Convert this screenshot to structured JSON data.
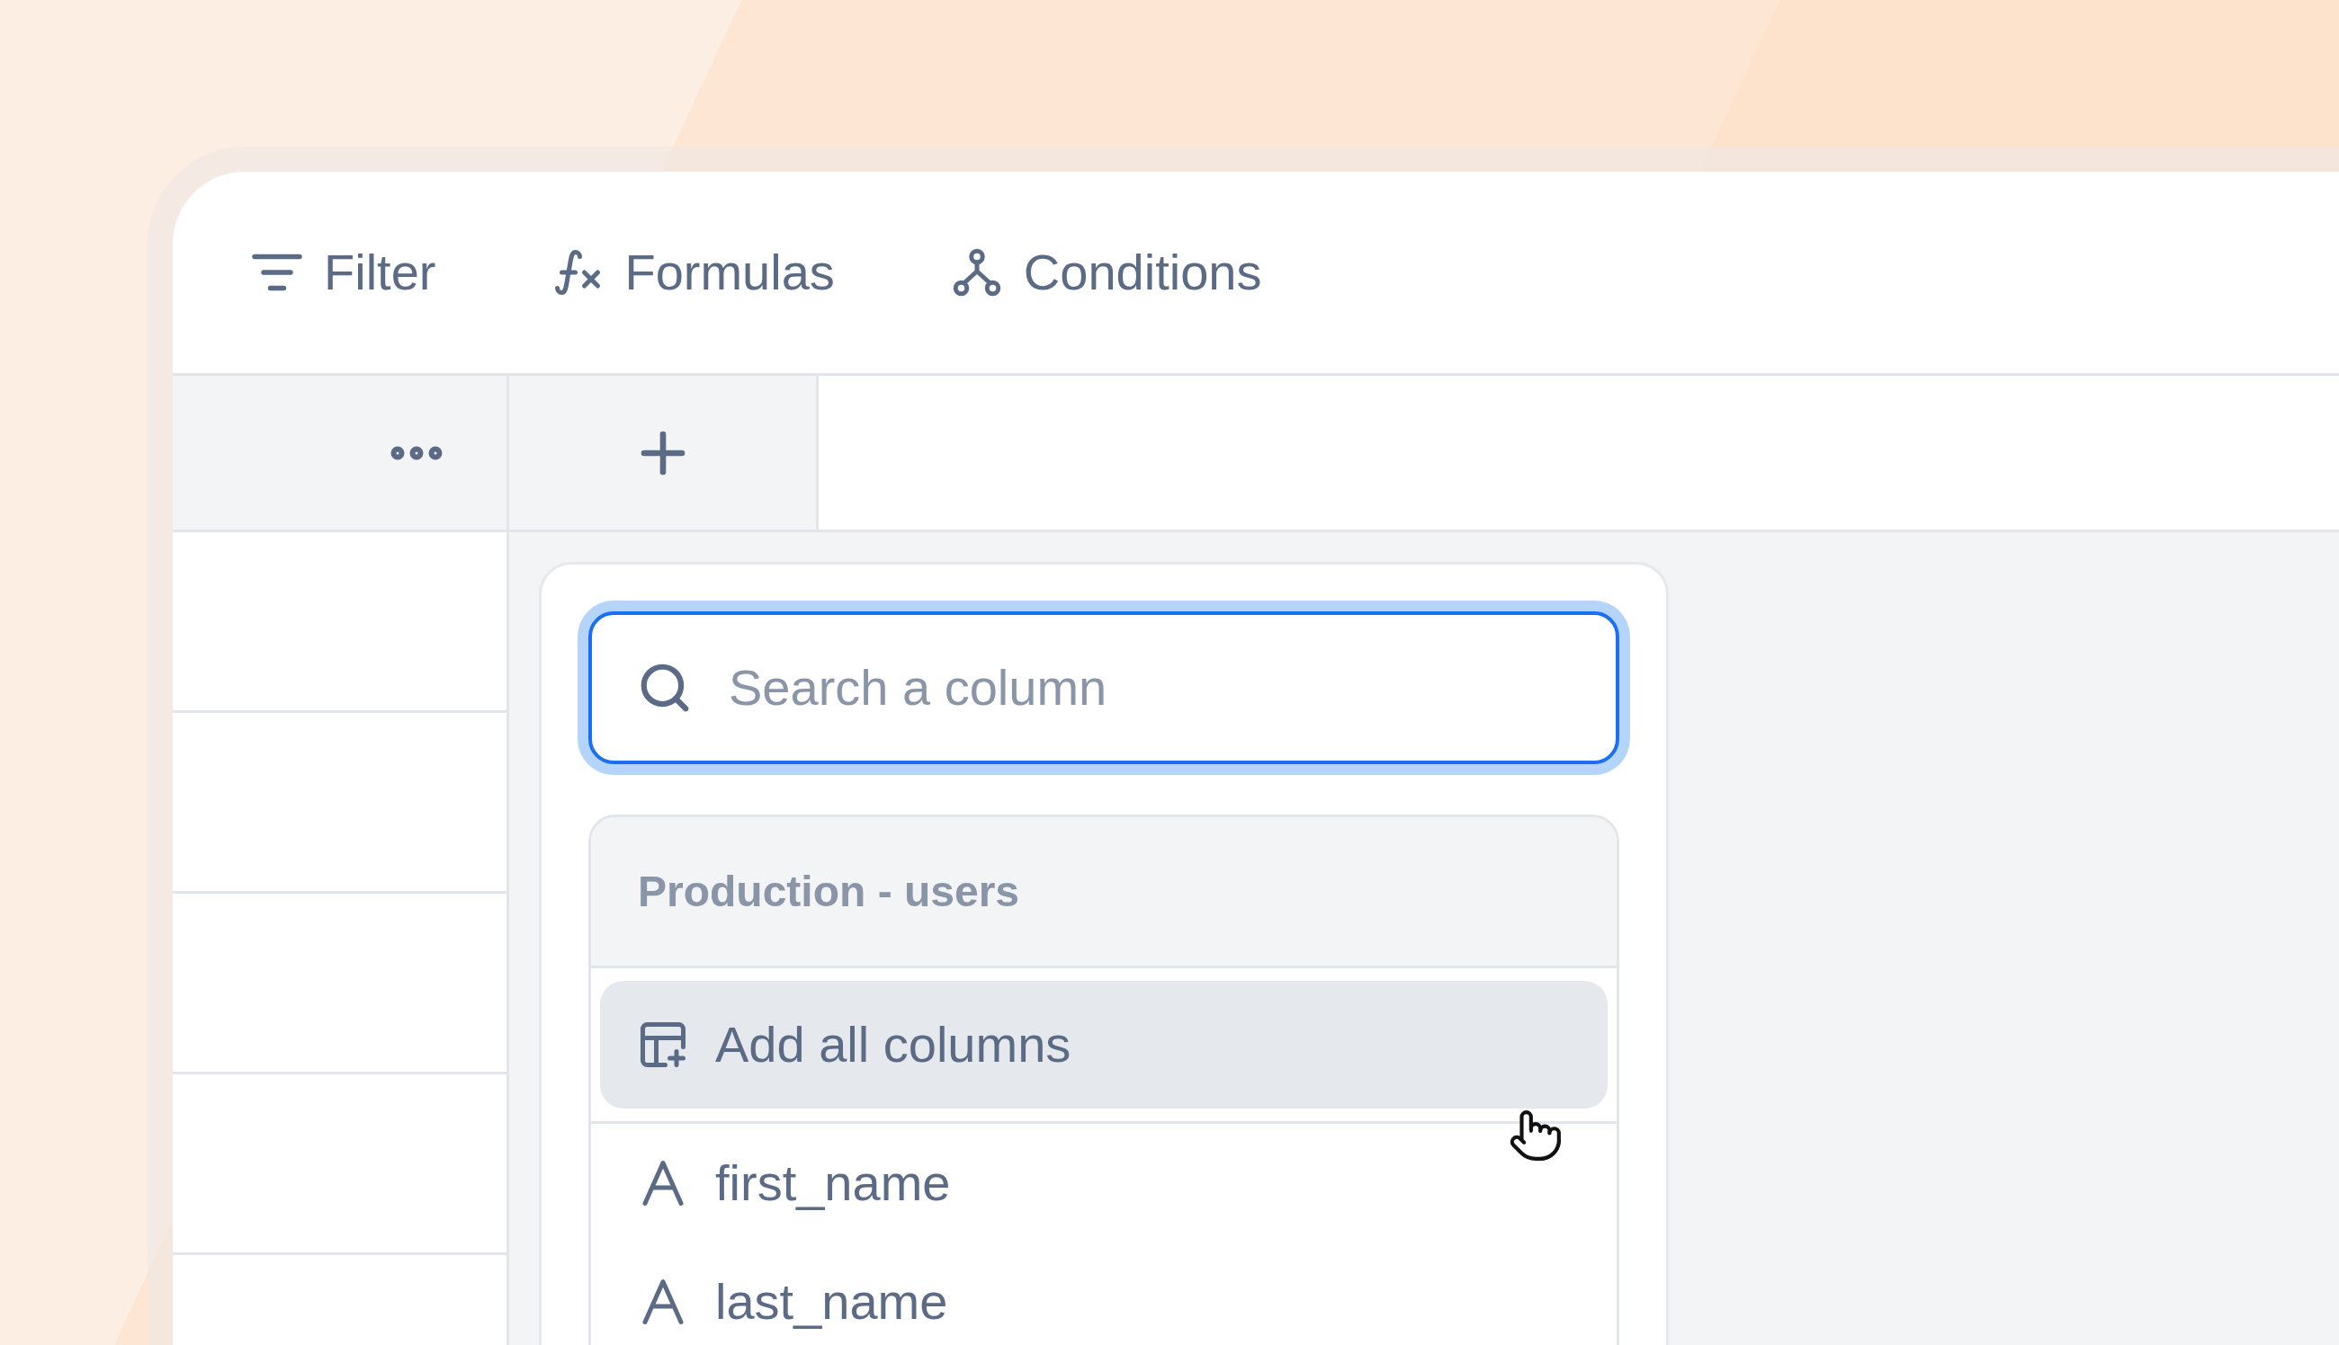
{
  "toolbar": [
    {
      "kind": "filter",
      "label": "Filter"
    },
    {
      "kind": "formulas",
      "label": "Formulas"
    },
    {
      "kind": "conditions",
      "label": "Conditions"
    }
  ],
  "column_picker": {
    "search": {
      "placeholder": "Search a column",
      "focused": true
    },
    "group": {
      "title": "Production - users",
      "items": [
        {
          "kind": "add_all",
          "label": "Add all columns",
          "selected": true
        },
        {
          "kind": "text",
          "label": "first_name",
          "selected": false
        },
        {
          "kind": "text",
          "label": "last_name",
          "selected": false
        }
      ]
    }
  }
}
